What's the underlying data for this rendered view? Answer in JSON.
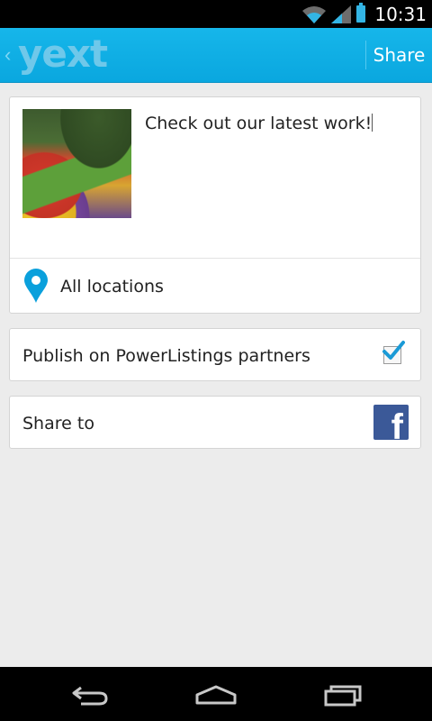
{
  "status_bar": {
    "time": "10:31",
    "icons": [
      "wifi-icon",
      "signal-icon",
      "battery-icon"
    ]
  },
  "action_bar": {
    "logo": "yext",
    "share_label": "Share",
    "accent": "#0aa7df"
  },
  "post": {
    "message": "Check out our latest work!",
    "location_label": "All locations"
  },
  "options": {
    "publish_label": "Publish on PowerListings partners",
    "publish_checked": true,
    "share_to_label": "Share to"
  },
  "nav": {
    "icons": [
      "back-icon",
      "home-icon",
      "recents-icon"
    ]
  }
}
